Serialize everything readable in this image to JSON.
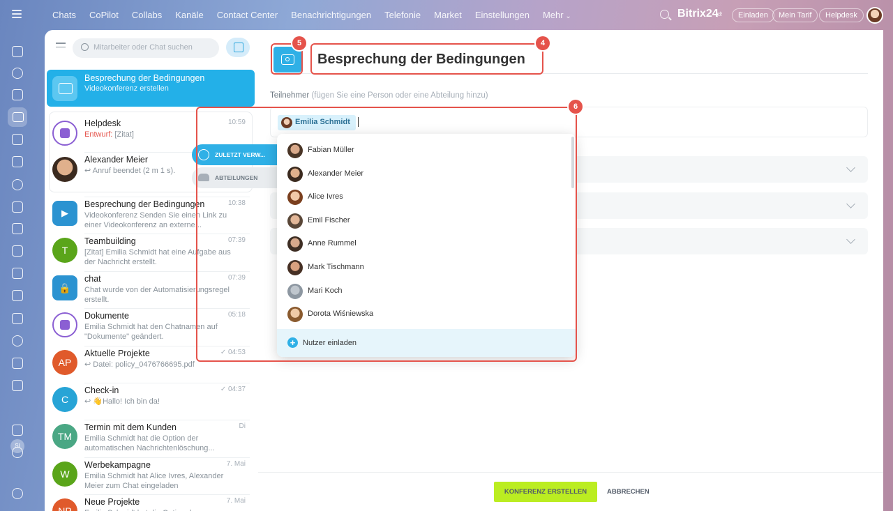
{
  "topbar": {
    "nav": [
      "Chats",
      "CoPilot",
      "Collabs",
      "Kanäle",
      "Contact Center",
      "Benachrichtigungen",
      "Telefonie",
      "Market",
      "Einstellungen",
      "Mehr"
    ],
    "brand": "Bitrix24",
    "brand_switch": "⇄",
    "invite": "Einladen",
    "tariff": "Mein Tarif",
    "helpdesk": "Helpdesk"
  },
  "rail": {
    "user_initials": "SI"
  },
  "chatlist": {
    "search_placeholder": "Mitarbeiter oder Chat suchen",
    "active": {
      "title": "Besprechung der Bedingungen",
      "subtitle": "Videokonferenz erstellen"
    },
    "items": [
      {
        "name": "Helpdesk",
        "draft_label": "Entwurf:",
        "msg": " [Zitat]",
        "time": "10:59",
        "avatar": "doc"
      },
      {
        "name": "Alexander Meier",
        "msg": "↩ Anruf beendet (2 m 1 s).",
        "time": "",
        "avatar": "photo"
      },
      {
        "name": "Besprechung der Bedingungen",
        "msg": "Videokonferenz Senden Sie einen Link zu einer Videokonferenz an externe...",
        "time": "10:38",
        "avatar": "video",
        "color": "#2b93d1"
      },
      {
        "name": "Teambuilding",
        "msg": "[Zitat] Emilia Schmidt hat eine Aufgabe aus der Nachricht erstellt.",
        "time": "07:39",
        "initials": "T",
        "color": "#5aa51a"
      },
      {
        "name": "chat",
        "msg": "Chat wurde von der Automatisierungsregel erstellt.",
        "time": "07:39",
        "avatar": "lock",
        "color": "#2b93d1"
      },
      {
        "name": "Dokumente",
        "msg": "Emilia Schmidt hat den Chatnamen auf \"Dokumente\" geändert.",
        "time": "05:18",
        "avatar": "doc"
      },
      {
        "name": "Aktuelle Projekte",
        "msg": "↩ Datei: policy_0476766695.pdf",
        "time": "✓ 04:53",
        "initials": "AP",
        "color": "#e05a2b"
      },
      {
        "name": "Check-in",
        "msg": "↩ 👋Hallo! Ich bin da!",
        "time": "✓ 04:37",
        "initials": "C",
        "color": "#27a4d6"
      },
      {
        "name": "Termin mit dem Kunden",
        "msg": "Emilia Schmidt hat die Option der automatischen Nachrichtenlöschung...",
        "time": "Di",
        "initials": "TM",
        "color": "#4aa784"
      },
      {
        "name": "Werbekampagne",
        "msg": "Emilia Schmidt hat Alice Ivres, Alexander Meier zum Chat eingeladen",
        "time": "7. Mai",
        "initials": "W",
        "color": "#5aa51a"
      },
      {
        "name": "Neue Projekte",
        "msg": "Emilia Schmidt hat die Option der",
        "time": "7. Mai",
        "initials": "NP",
        "color": "#e05a2b"
      }
    ]
  },
  "main": {
    "title": "Besprechung der Bedingungen",
    "participants_label": "Teilnehmer",
    "participants_hint": "(fügen Sie eine Person oder eine Abteilung hinzu)",
    "selected_chip": "Emilia Schmidt",
    "create_button": "KONFERENZ ERSTELLEN",
    "cancel_button": "ABBRECHEN"
  },
  "dropdown": {
    "tabs": {
      "recent": "ZULETZT VERW...",
      "departments": "ABTEILUNGEN"
    },
    "people": [
      {
        "name": "Fabian Müller",
        "skin": "#d9a98a",
        "hair": "#4a3526"
      },
      {
        "name": "Alexander Meier",
        "skin": "#e0b08c",
        "hair": "#3b2a1f"
      },
      {
        "name": "Alice Ivres",
        "skin": "#f1c9a8",
        "hair": "#7a3f1e"
      },
      {
        "name": "Emil Fischer",
        "skin": "#e3b798",
        "hair": "#5a4738"
      },
      {
        "name": "Anne Rummel",
        "skin": "#d7a98c",
        "hair": "#3e2e24"
      },
      {
        "name": "Mark Tischmann",
        "skin": "#d9a17f",
        "hair": "#463024"
      },
      {
        "name": "Mari Koch",
        "skin": "#bfc6cd",
        "hair": "#8d97a1"
      },
      {
        "name": "Dorota Wiśniewska",
        "skin": "#f0caa6",
        "hair": "#8a5a2e"
      }
    ],
    "invite_label": "Nutzer einladen"
  },
  "annotations": {
    "badge_4": "4",
    "badge_5": "5",
    "badge_6": "6"
  },
  "colors": {
    "accent": "#2fb0e6",
    "create": "#bbed21",
    "annotation": "#e5534b"
  }
}
